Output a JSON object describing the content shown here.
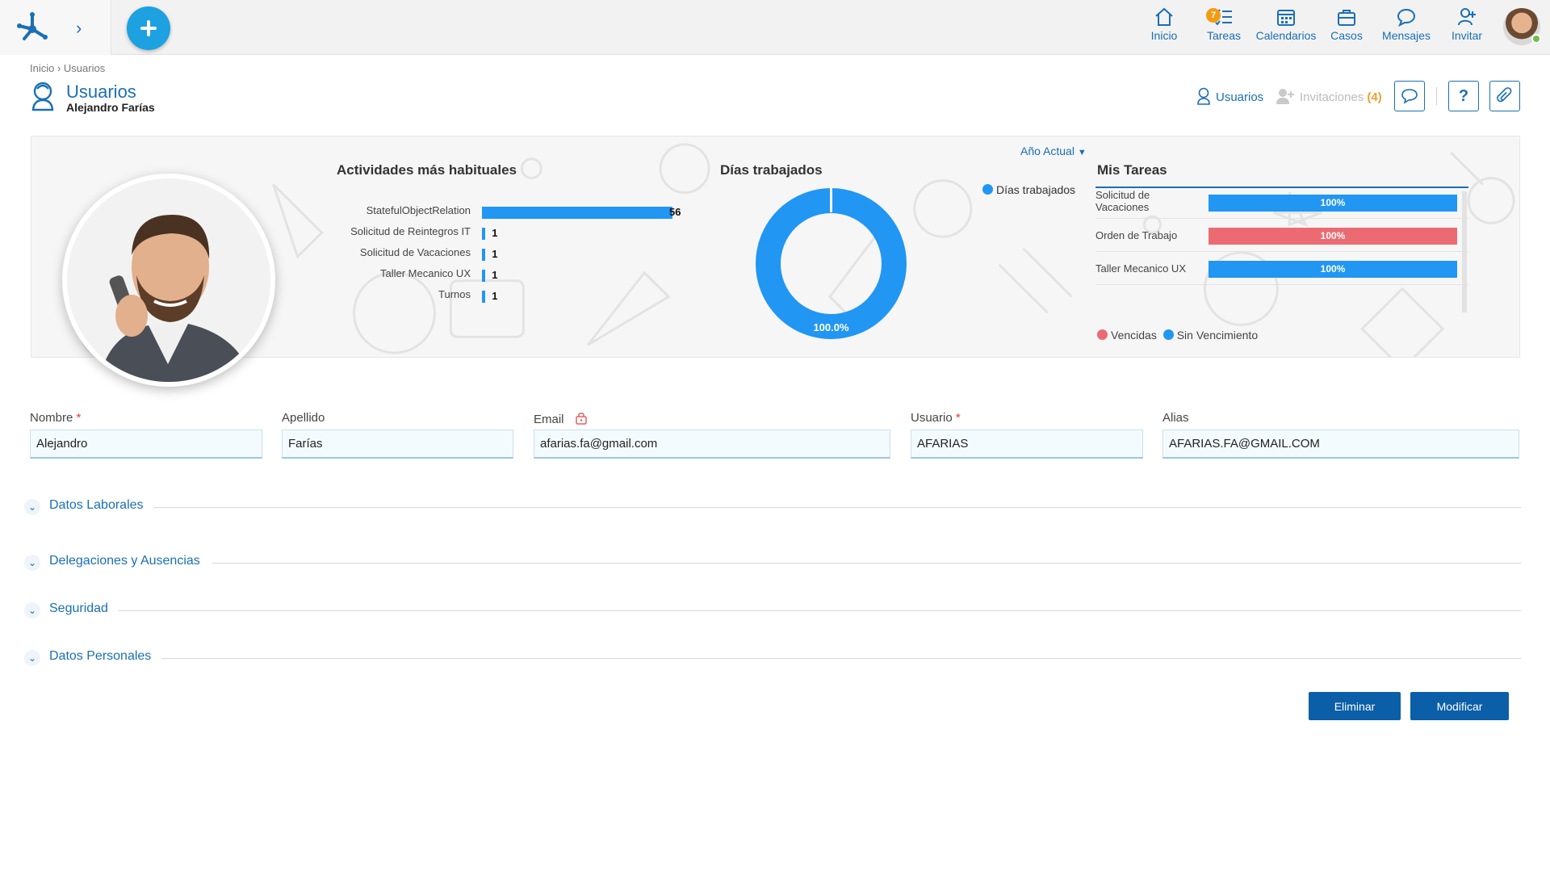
{
  "nav": {
    "items": [
      {
        "label": "Inicio",
        "icon": "home-icon"
      },
      {
        "label": "Tareas",
        "icon": "tasks-icon",
        "badge": "7"
      },
      {
        "label": "Calendarios",
        "icon": "calendar-icon"
      },
      {
        "label": "Casos",
        "icon": "briefcase-icon"
      },
      {
        "label": "Mensajes",
        "icon": "chat-icon"
      },
      {
        "label": "Invitar",
        "icon": "invite-icon"
      }
    ]
  },
  "breadcrumb": "Inicio › Usuarios",
  "header": {
    "title": "Usuarios",
    "subtitle": "Alejandro Farías",
    "users_link": "Usuarios",
    "invitations_label": "Invitaciones",
    "invitations_count": "(4)"
  },
  "dashboard": {
    "activities_title": "Actividades más habituales",
    "days_title": "Días trabajados",
    "tasks_title": "Mis Tareas",
    "year_select": "Año Actual",
    "donut_legend": "Días trabajados",
    "task_legend_overdue": "Vencidas",
    "task_legend_no_due": "Sin Vencimiento",
    "colors": {
      "blue": "#2196f3",
      "red": "#ec6b73"
    }
  },
  "chart_data": [
    {
      "type": "bar",
      "title": "Actividades más habituales",
      "orientation": "horizontal",
      "categories": [
        "StatefulObjectRelation",
        "Solicitud de Reintegros IT",
        "Solicitud de Vacaciones",
        "Taller Mecanico UX",
        "Turnos"
      ],
      "values": [
        56,
        1,
        1,
        1,
        1
      ],
      "value_labels": [
        "56",
        "1",
        "1",
        "1",
        "1"
      ]
    },
    {
      "type": "pie",
      "title": "Días trabajados",
      "labels": [
        "Días trabajados"
      ],
      "values": [
        100.0
      ],
      "value_label": "100.0%"
    },
    {
      "type": "bar",
      "title": "Mis Tareas",
      "orientation": "horizontal",
      "categories": [
        "Solicitud de Vacaciones",
        "Orden de Trabajo",
        "Taller Mecanico UX"
      ],
      "values": [
        100,
        100,
        100
      ],
      "value_labels": [
        "100%",
        "100%",
        "100%"
      ],
      "series_status": [
        "Sin Vencimiento",
        "Vencidas",
        "Sin Vencimiento"
      ],
      "legend": [
        "Vencidas",
        "Sin Vencimiento"
      ]
    }
  ],
  "form": {
    "nombre_label": "Nombre",
    "nombre_value": "Alejandro",
    "apellido_label": "Apellido",
    "apellido_value": "Farías",
    "email_label": "Email",
    "email_value": "afarias.fa@gmail.com",
    "usuario_label": "Usuario",
    "usuario_value": "AFARIAS",
    "alias_label": "Alias",
    "alias_value": "AFARIAS.FA@GMAIL.COM",
    "required_mark": "*"
  },
  "sections": [
    "Datos Laborales",
    "Delegaciones y Ausencias",
    "Seguridad",
    "Datos Personales"
  ],
  "actions": {
    "delete": "Eliminar",
    "modify": "Modificar"
  }
}
